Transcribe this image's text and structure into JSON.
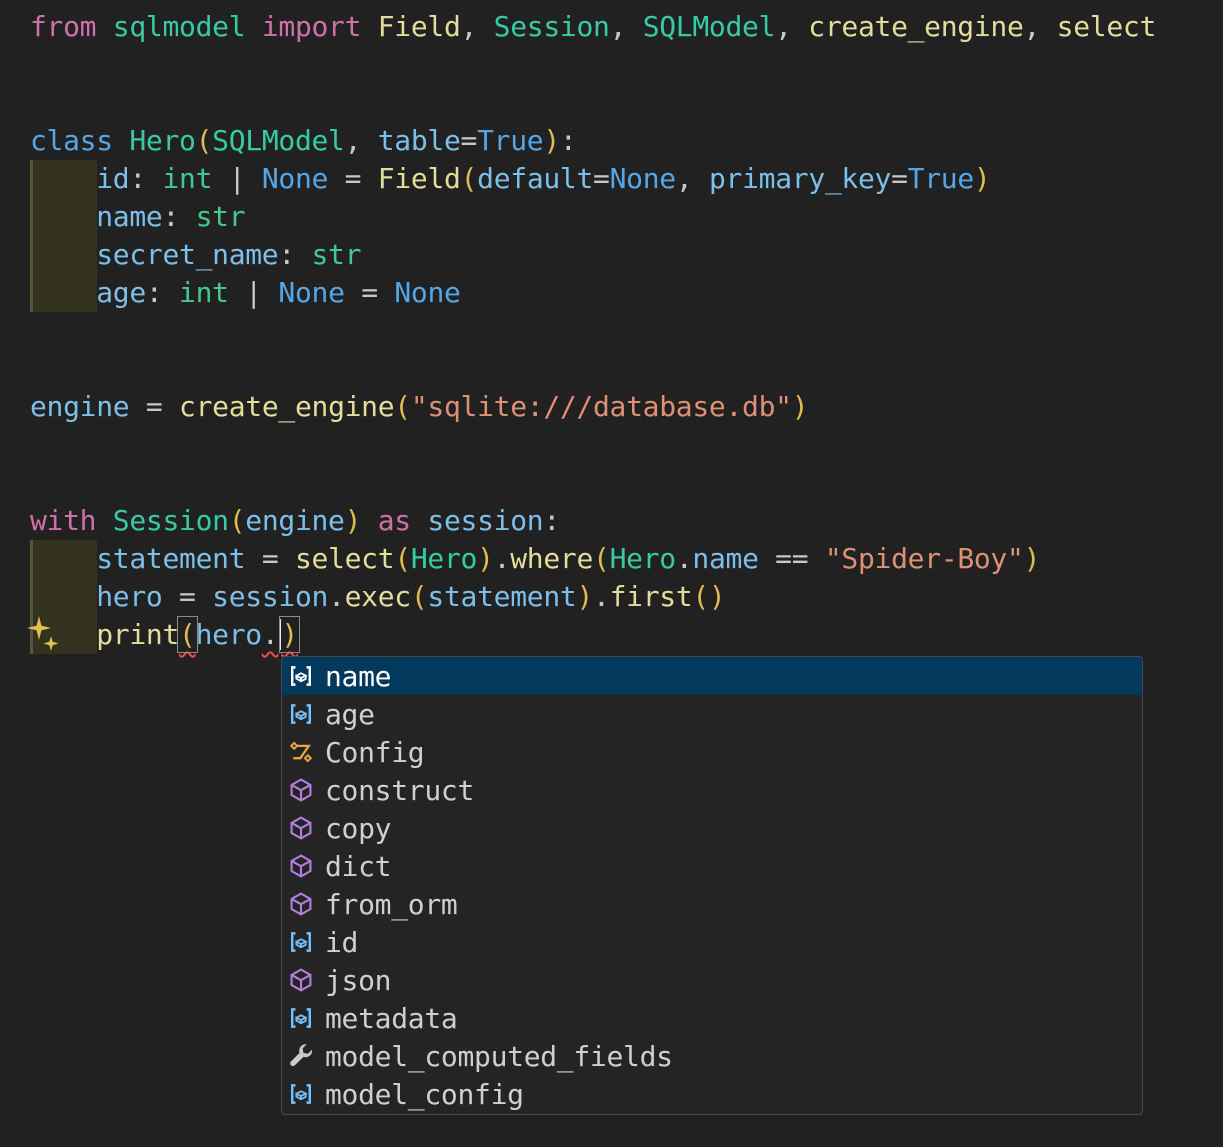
{
  "theme": {
    "editor_background": "#212121",
    "keyword_pink": "#cf71a9",
    "keyword_blue": "#55a6e6",
    "class_teal": "#37cba4",
    "type_green": "#41c98f",
    "function_yellow": "#e2dd9a",
    "variable_blue": "#7cbfe9",
    "string_salmon": "#de9074",
    "punctuation_gray": "#c8c8c8",
    "bracket_gold": "#dcbd4d",
    "error_squiggle_red": "#f14c4c",
    "indent_highlight": "#32321f",
    "suggest_background": "#242424",
    "suggest_border": "#4a4a4a",
    "suggest_selected_background": "#04395e",
    "icon_field_blue": "#75beff",
    "icon_method_purple": "#b47ede",
    "icon_class_orange": "#e8a343",
    "icon_property_gray": "#cbcbcb",
    "sparkle_gold": "#e5c14b"
  },
  "code": {
    "lines": [
      {
        "tokens": [
          [
            "kw",
            "from "
          ],
          [
            "cls",
            "sqlmodel "
          ],
          [
            "kw",
            "import "
          ],
          [
            "fn",
            "Field"
          ],
          [
            "pu",
            ", "
          ],
          [
            "cls",
            "Session"
          ],
          [
            "pu",
            ", "
          ],
          [
            "cls",
            "SQLModel"
          ],
          [
            "pu",
            ", "
          ],
          [
            "fn",
            "create_engine"
          ],
          [
            "pu",
            ", "
          ],
          [
            "fn",
            "select"
          ]
        ]
      },
      {
        "tokens": []
      },
      {
        "tokens": []
      },
      {
        "tokens": [
          [
            "kw2",
            "class "
          ],
          [
            "cls",
            "Hero"
          ],
          [
            "br",
            "("
          ],
          [
            "cls",
            "SQLModel"
          ],
          [
            "pu",
            ", "
          ],
          [
            "var",
            "table"
          ],
          [
            "pu",
            "="
          ],
          [
            "kw2",
            "True"
          ],
          [
            "br",
            ")"
          ],
          [
            "pu",
            ":"
          ]
        ]
      },
      {
        "tokens": [
          [
            "pl",
            "    "
          ],
          [
            "var",
            "id"
          ],
          [
            "pu",
            ": "
          ],
          [
            "type",
            "int"
          ],
          [
            "pu",
            " | "
          ],
          [
            "kw2",
            "None"
          ],
          [
            "pu",
            " = "
          ],
          [
            "fn",
            "Field"
          ],
          [
            "br",
            "("
          ],
          [
            "var",
            "default"
          ],
          [
            "pu",
            "="
          ],
          [
            "kw2",
            "None"
          ],
          [
            "pu",
            ", "
          ],
          [
            "var",
            "primary_key"
          ],
          [
            "pu",
            "="
          ],
          [
            "kw2",
            "True"
          ],
          [
            "br",
            ")"
          ]
        ]
      },
      {
        "tokens": [
          [
            "pl",
            "    "
          ],
          [
            "var",
            "name"
          ],
          [
            "pu",
            ": "
          ],
          [
            "type",
            "str"
          ]
        ]
      },
      {
        "tokens": [
          [
            "pl",
            "    "
          ],
          [
            "var",
            "secret_name"
          ],
          [
            "pu",
            ": "
          ],
          [
            "type",
            "str"
          ]
        ]
      },
      {
        "tokens": [
          [
            "pl",
            "    "
          ],
          [
            "var",
            "age"
          ],
          [
            "pu",
            ": "
          ],
          [
            "type",
            "int"
          ],
          [
            "pu",
            " | "
          ],
          [
            "kw2",
            "None"
          ],
          [
            "pu",
            " = "
          ],
          [
            "kw2",
            "None"
          ]
        ]
      },
      {
        "tokens": []
      },
      {
        "tokens": []
      },
      {
        "tokens": [
          [
            "var",
            "engine"
          ],
          [
            "pu",
            " = "
          ],
          [
            "fn",
            "create_engine"
          ],
          [
            "br",
            "("
          ],
          [
            "str",
            "\"sqlite:///database.db\""
          ],
          [
            "br",
            ")"
          ]
        ]
      },
      {
        "tokens": []
      },
      {
        "tokens": []
      },
      {
        "tokens": [
          [
            "kw",
            "with "
          ],
          [
            "cls",
            "Session"
          ],
          [
            "br",
            "("
          ],
          [
            "var",
            "engine"
          ],
          [
            "br",
            ")"
          ],
          [
            "kw",
            " as "
          ],
          [
            "var",
            "session"
          ],
          [
            "pu",
            ":"
          ]
        ]
      },
      {
        "tokens": [
          [
            "pl",
            "    "
          ],
          [
            "var",
            "statement"
          ],
          [
            "pu",
            " = "
          ],
          [
            "fn",
            "select"
          ],
          [
            "br",
            "("
          ],
          [
            "cls",
            "Hero"
          ],
          [
            "br",
            ")"
          ],
          [
            "pu",
            "."
          ],
          [
            "fn",
            "where"
          ],
          [
            "br",
            "("
          ],
          [
            "cls",
            "Hero"
          ],
          [
            "pu",
            "."
          ],
          [
            "var",
            "name"
          ],
          [
            "pu",
            " == "
          ],
          [
            "str",
            "\"Spider-Boy\""
          ],
          [
            "br",
            ")"
          ]
        ]
      },
      {
        "tokens": [
          [
            "pl",
            "    "
          ],
          [
            "var",
            "hero"
          ],
          [
            "pu",
            " = "
          ],
          [
            "var",
            "session"
          ],
          [
            "pu",
            "."
          ],
          [
            "fn",
            "exec"
          ],
          [
            "br",
            "("
          ],
          [
            "var",
            "statement"
          ],
          [
            "br",
            ")"
          ],
          [
            "pu",
            "."
          ],
          [
            "fn",
            "first"
          ],
          [
            "br",
            "()"
          ]
        ]
      },
      {
        "tokens": [
          [
            "pl",
            "    "
          ],
          [
            "fn",
            "print"
          ],
          [
            "br",
            "(",
            "box sq"
          ],
          [
            "var",
            "hero"
          ],
          [
            "pu",
            ".",
            "sq"
          ],
          [
            "caret",
            ""
          ],
          [
            "br",
            ")",
            "box sq"
          ]
        ]
      }
    ]
  },
  "gutter": {
    "sparkle_icon": "copilot-sparkle-icon",
    "sparkle_line": 17
  },
  "suggest": {
    "items": [
      {
        "label": "name",
        "kind": "field",
        "icon": "symbol-field-icon",
        "selected": true
      },
      {
        "label": "age",
        "kind": "field",
        "icon": "symbol-field-icon",
        "selected": false
      },
      {
        "label": "Config",
        "kind": "class",
        "icon": "symbol-class-icon",
        "selected": false
      },
      {
        "label": "construct",
        "kind": "method",
        "icon": "symbol-method-icon",
        "selected": false
      },
      {
        "label": "copy",
        "kind": "method",
        "icon": "symbol-method-icon",
        "selected": false
      },
      {
        "label": "dict",
        "kind": "method",
        "icon": "symbol-method-icon",
        "selected": false
      },
      {
        "label": "from_orm",
        "kind": "method",
        "icon": "symbol-method-icon",
        "selected": false
      },
      {
        "label": "id",
        "kind": "field",
        "icon": "symbol-field-icon",
        "selected": false
      },
      {
        "label": "json",
        "kind": "method",
        "icon": "symbol-method-icon",
        "selected": false
      },
      {
        "label": "metadata",
        "kind": "field",
        "icon": "symbol-field-icon",
        "selected": false
      },
      {
        "label": "model_computed_fields",
        "kind": "property",
        "icon": "symbol-property-icon",
        "selected": false
      },
      {
        "label": "model_config",
        "kind": "field",
        "icon": "symbol-field-icon",
        "selected": false
      }
    ]
  }
}
